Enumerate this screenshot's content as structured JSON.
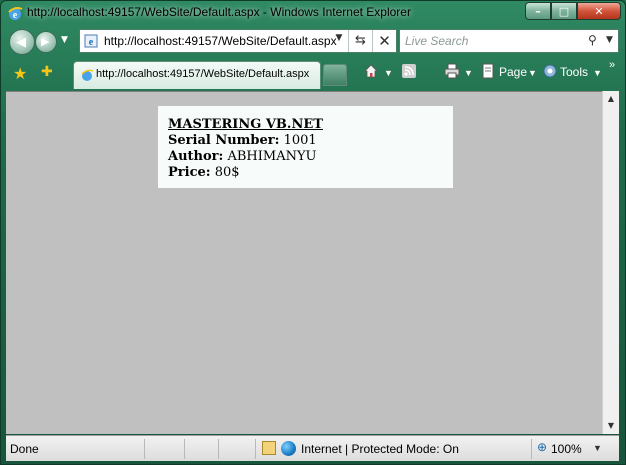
{
  "window": {
    "title": "http://localhost:49157/WebSite/Default.aspx - Windows Internet Explorer",
    "minimize_glyph": "–",
    "maximize_glyph": "□",
    "close_glyph": "✕"
  },
  "nav": {
    "back_glyph": "◀",
    "forward_glyph": "▶",
    "address": "http://localhost:49157/WebSite/Default.aspx",
    "search_placeholder": "Live Search"
  },
  "tab": {
    "label": "http://localhost:49157/WebSite/Default.aspx"
  },
  "toolbar": {
    "page_label": "Page",
    "tools_label": "Tools"
  },
  "content": {
    "book_title": "MASTERING VB.NET",
    "serial_label": "Serial Number:",
    "serial_value": "1001",
    "author_label": "Author:",
    "author_value": "ABHIMANYU",
    "price_label": "Price:",
    "price_value": "80$"
  },
  "status": {
    "text": "Done",
    "zone": "Internet | Protected Mode: On",
    "zoom": "100%"
  },
  "colors": {
    "frame": "#1f6b4a",
    "content_bg": "#c0c0c0",
    "card_bg": "#f7fbfa"
  }
}
